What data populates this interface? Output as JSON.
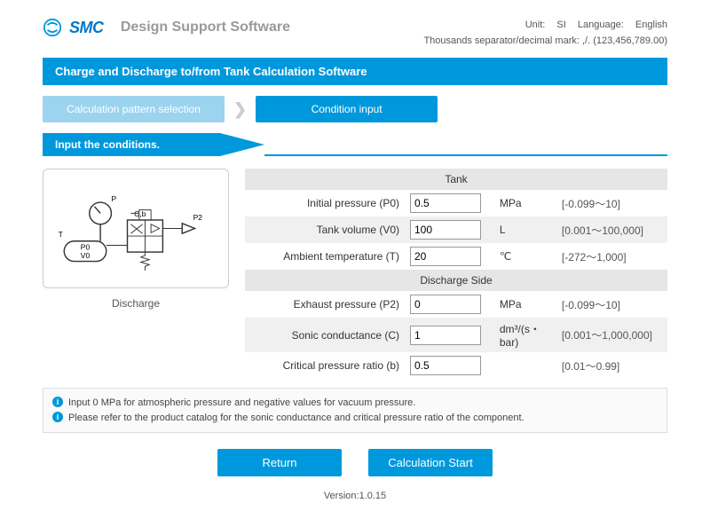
{
  "header": {
    "logo_text": "SMC",
    "app_title": "Design Support Software",
    "unit_label": "Unit:",
    "unit_value": "SI",
    "lang_label": "Language:",
    "lang_value": "English",
    "separator_note": "Thousands separator/decimal mark: ,/. (123,456,789.00)"
  },
  "title_bar": "Charge and Discharge to/from Tank Calculation Software",
  "breadcrumb": {
    "step1": "Calculation pattern selection",
    "step2": "Condition input"
  },
  "section_label": "Input the conditions.",
  "diagram": {
    "caption": "Discharge",
    "labels": {
      "P": "P",
      "T": "T",
      "Cb": "C,b",
      "P0": "P0",
      "V0": "V0",
      "P2": "P2"
    }
  },
  "form": {
    "tank_header": "Tank",
    "discharge_header": "Discharge Side",
    "rows": {
      "p0": {
        "label": "Initial pressure (P0)",
        "value": "0.5",
        "unit": "MPa",
        "range": "[-0.099～10]"
      },
      "v0": {
        "label": "Tank volume (V0)",
        "value": "100",
        "unit": "L",
        "range": "[0.001～100,000]"
      },
      "t": {
        "label": "Ambient temperature (T)",
        "value": "20",
        "unit": "℃",
        "range": "[-272～1,000]"
      },
      "p2": {
        "label": "Exhaust pressure (P2)",
        "value": "0",
        "unit": "MPa",
        "range": "[-0.099～10]"
      },
      "c": {
        "label": "Sonic conductance (C)",
        "value": "1",
        "unit": "dm³/(s・bar)",
        "range": "[0.001～1,000,000]"
      },
      "b": {
        "label": "Critical pressure ratio (b)",
        "value": "0.5",
        "unit": "",
        "range": "[0.01～0.99]"
      }
    }
  },
  "info": {
    "line1": "Input 0 MPa for atmospheric pressure and negative values for vacuum pressure.",
    "line2": "Please refer to the product catalog for the sonic conductance and critical pressure ratio of the component."
  },
  "buttons": {
    "return": "Return",
    "start": "Calculation Start"
  },
  "version": "Version:1.0.15"
}
